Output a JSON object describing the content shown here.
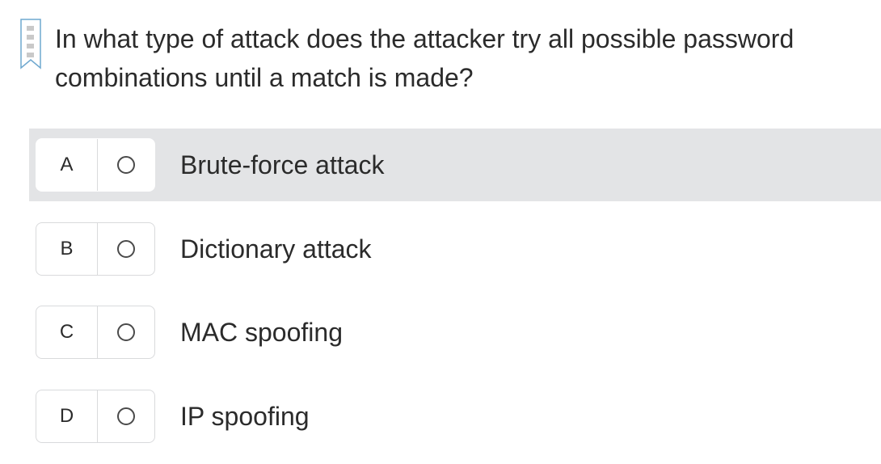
{
  "question": {
    "text": "In what type of attack does the attacker try all possible password combinations until a match is made?",
    "bookmark_icon": "bookmark-icon"
  },
  "options": [
    {
      "letter": "A",
      "text": "Brute-force attack",
      "highlighted": true
    },
    {
      "letter": "B",
      "text": "Dictionary attack",
      "highlighted": false
    },
    {
      "letter": "C",
      "text": "MAC spoofing",
      "highlighted": false
    },
    {
      "letter": "D",
      "text": "IP spoofing",
      "highlighted": false
    }
  ],
  "colors": {
    "highlight": "#e3e4e6",
    "text": "#2b2b2b",
    "border": "#d9dadc",
    "bookmark": "#6fa8cf"
  }
}
